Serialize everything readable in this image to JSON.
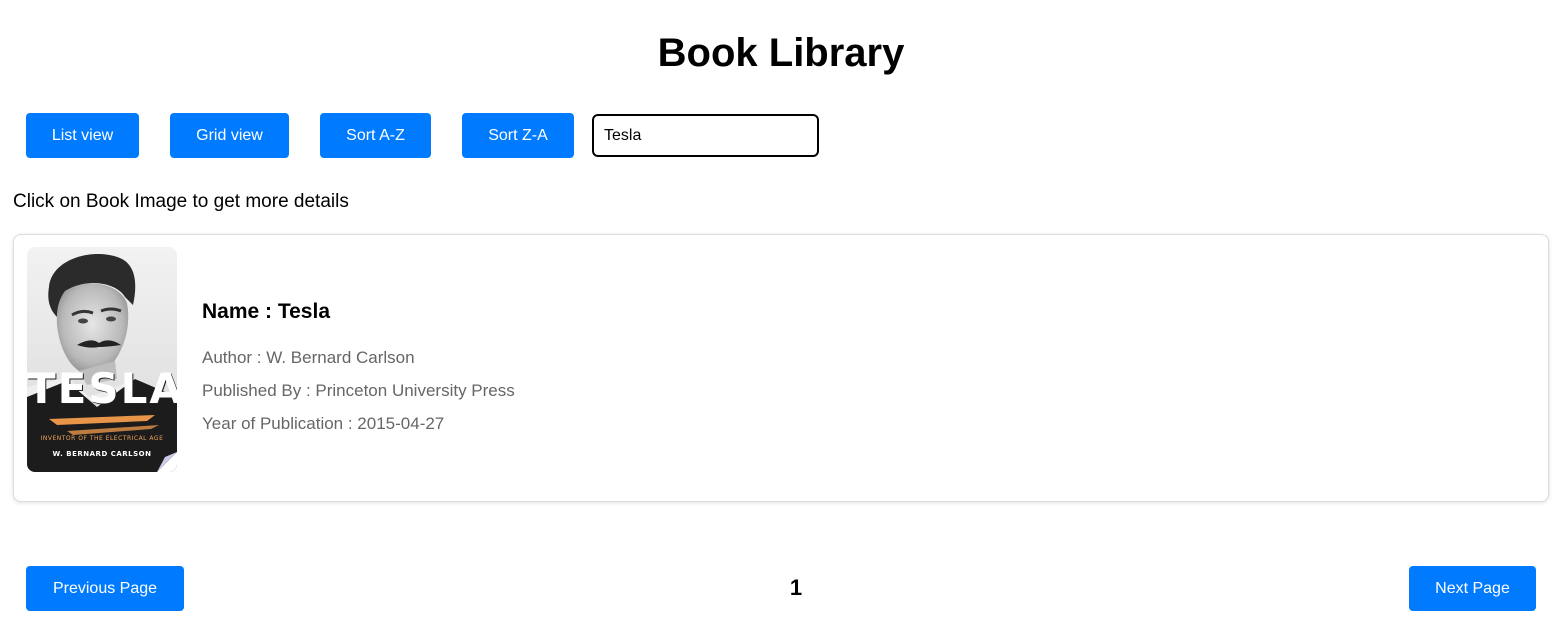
{
  "header": {
    "title": "Book Library"
  },
  "toolbar": {
    "list_view_label": "List view",
    "grid_view_label": "Grid view",
    "sort_az_label": "Sort A-Z",
    "sort_za_label": "Sort Z-A",
    "search_value": "Tesla"
  },
  "hint": "Click on Book Image to get more details",
  "books": [
    {
      "cover": {
        "title": "TESLA",
        "subtitle": "INVENTOR OF THE ELECTRICAL AGE",
        "author": "W. BERNARD CARLSON"
      },
      "name_line": "Name : Tesla",
      "author_line": "Author : W. Bernard Carlson",
      "publisher_line": "Published By : Princeton University Press",
      "year_line": "Year of Publication : 2015-04-27"
    }
  ],
  "pagination": {
    "prev_label": "Previous Page",
    "current_page": "1",
    "next_label": "Next Page"
  },
  "colors": {
    "accent": "#007bff",
    "meta_text": "#666666"
  }
}
